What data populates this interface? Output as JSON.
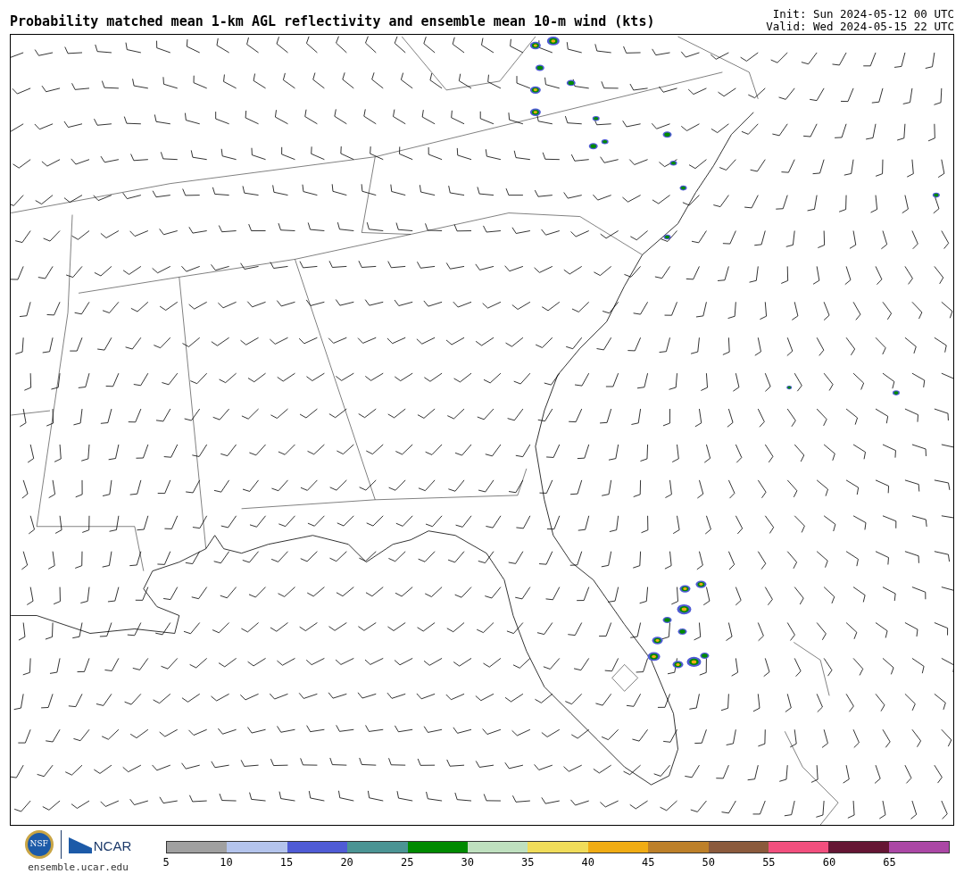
{
  "header": {
    "title": "Probability matched mean 1-km AGL reflectivity and ensemble mean 10-m wind (kts)",
    "init": "Init: Sun 2024-05-12 00 UTC",
    "valid": "Valid: Wed 2024-05-15 22 UTC"
  },
  "footer": {
    "nsf_logo": "NSF",
    "ncar_logo": "NCAR",
    "url": "ensemble.ucar.edu"
  },
  "colorbar": {
    "segments": [
      {
        "color": "#a0a0a0"
      },
      {
        "color": "#b4c4ec"
      },
      {
        "color": "#4f5bd5"
      },
      {
        "color": "#4b9494"
      },
      {
        "color": "#008a00"
      },
      {
        "color": "#bfe0bf"
      },
      {
        "color": "#f0dc5a"
      },
      {
        "color": "#f0ac14"
      },
      {
        "color": "#bd8029"
      },
      {
        "color": "#8b5a3c"
      },
      {
        "color": "#f24f7e"
      },
      {
        "color": "#651634"
      },
      {
        "color": "#ab47a5"
      }
    ],
    "labels": [
      "5",
      "10",
      "15",
      "20",
      "25",
      "30",
      "35",
      "40",
      "45",
      "50",
      "55",
      "60",
      "65"
    ]
  }
}
